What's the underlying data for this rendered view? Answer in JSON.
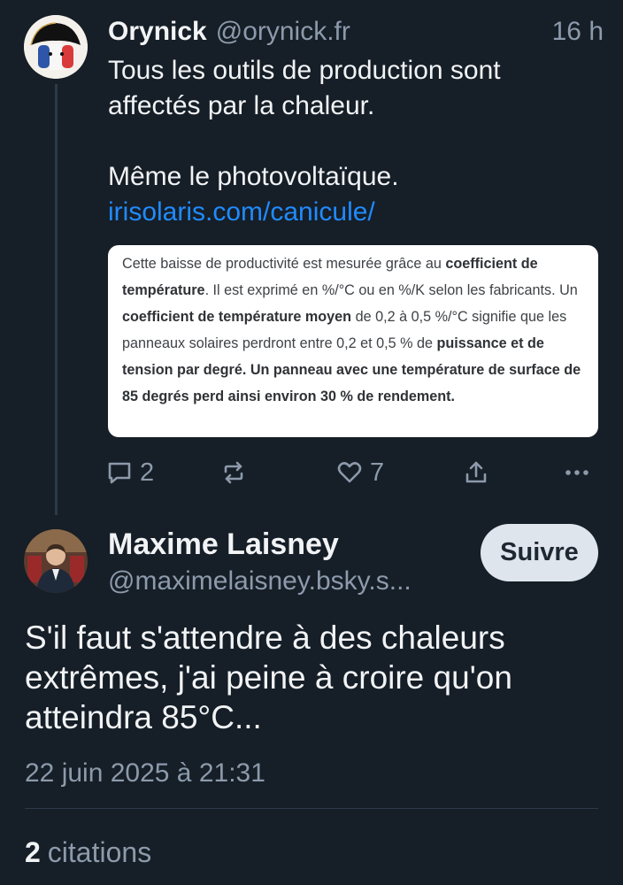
{
  "post1": {
    "author_name": "Orynick",
    "author_handle": "@orynick.fr",
    "time": "16 h",
    "text_line1": "Tous les outils de production sont",
    "text_line2": "affectés par la chaleur.",
    "text_line3": "Même le photovoltaïque.",
    "link": "irisolaris.com/canicule/",
    "embed": {
      "t1": "Cette baisse de productivité est mesurée grâce au ",
      "b1": "coefficient de température",
      "t2": ". Il est exprimé en %/°C ou en %/K selon les fabricants. Un ",
      "b2": "coefficient de température moyen",
      "t3": " de 0,2 à 0,5 %/°C signifie que les panneaux solaires perdront entre 0,2 et 0,5 % de ",
      "b3": "puissance et de tension par degré. Un panneau avec une température de surface de 85 degrés perd ainsi environ 30 % de rendement."
    },
    "actions": {
      "reply_icon": "speech-bubble-icon",
      "reply_count": "2",
      "repost_icon": "repost-arrows-icon",
      "like_icon": "heart-icon",
      "like_count": "7",
      "share_icon": "share-icon",
      "more_icon": "ellipsis-icon"
    }
  },
  "post2": {
    "author_name": "Maxime Laisney",
    "author_handle": "@maximelaisney.bsky.s...",
    "follow_label": "Suivre",
    "text": "S'il faut s'attendre à des chaleurs extrêmes, j'ai peine à croire qu'on atteindra 85°C...",
    "date": "22 juin 2025 à 21:31",
    "quotes_count": "2",
    "quotes_label": "citations"
  },
  "colors": {
    "background": "#161e27",
    "muted_text": "#8c9aab",
    "link": "#208bfe",
    "follow_button_bg": "#dfe5ec"
  }
}
